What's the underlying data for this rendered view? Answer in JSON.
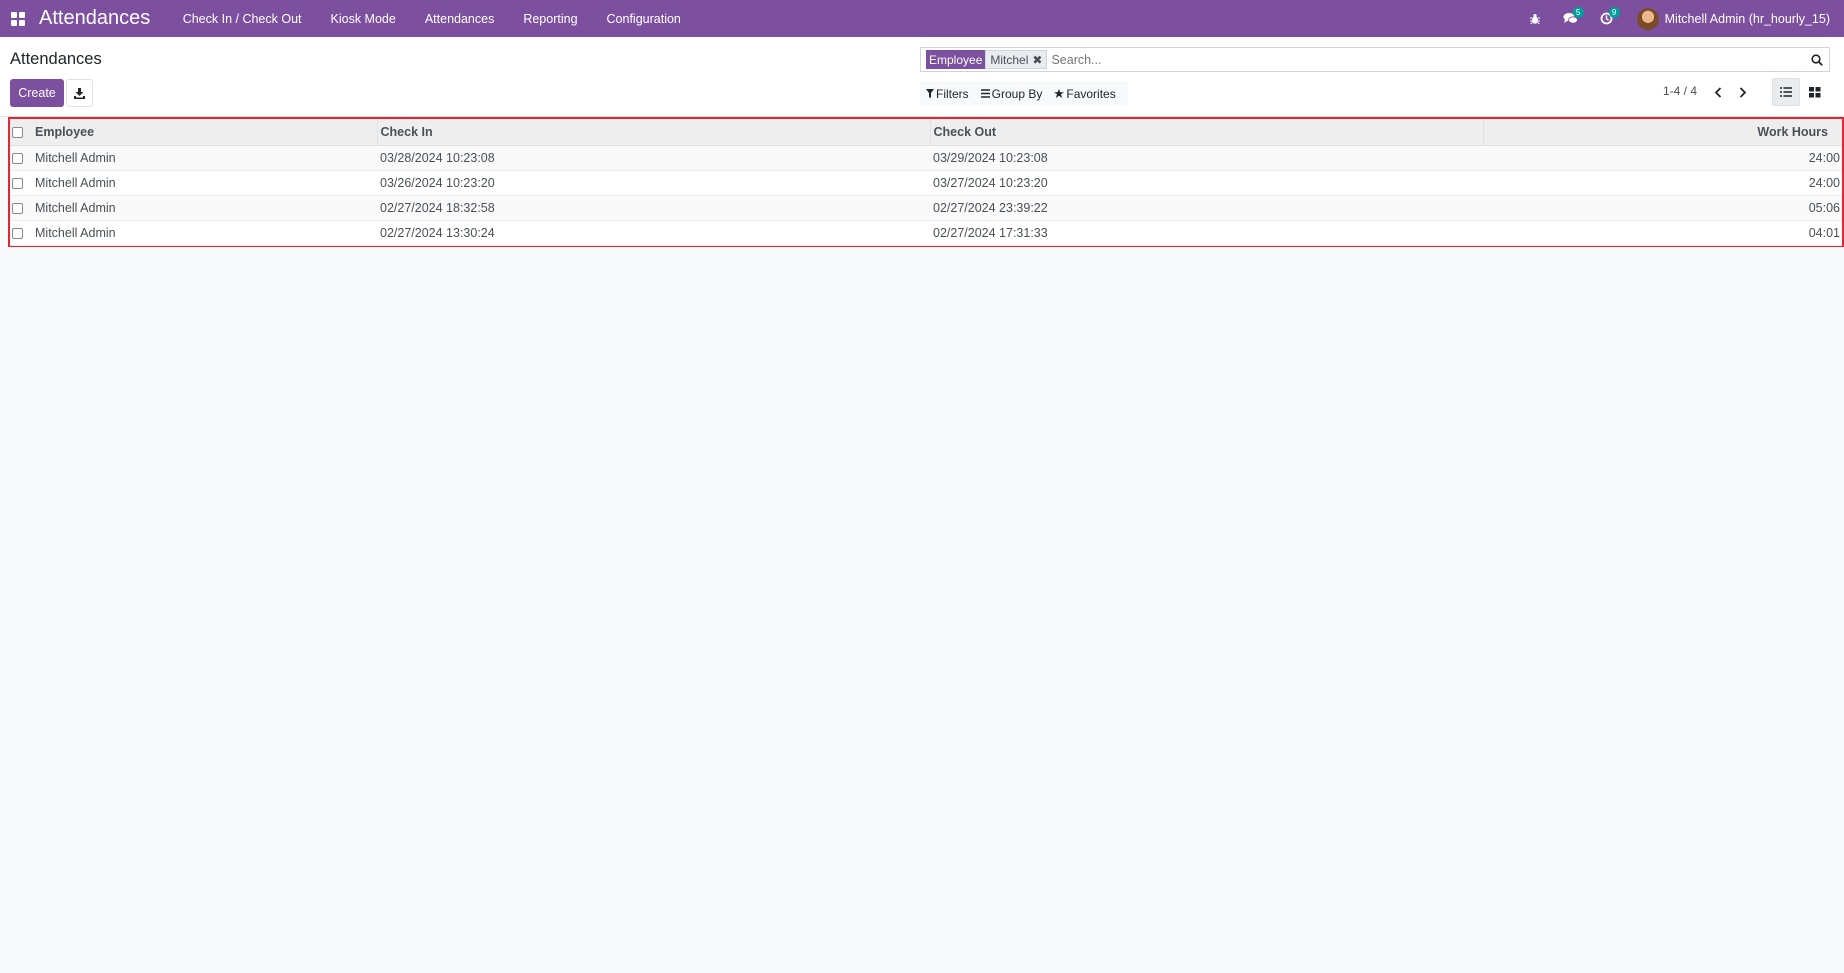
{
  "navbar": {
    "brand": "Attendances",
    "menu": [
      "Check In / Check Out",
      "Kiosk Mode",
      "Attendances",
      "Reporting",
      "Configuration"
    ],
    "icons": {
      "apps": "apps-grid-icon",
      "debug": "bug-icon",
      "messages": "chat-icon",
      "activities": "clock-icon"
    },
    "messages_count": "5",
    "activities_count": "9",
    "user_name": "Mitchell Admin (hr_hourly_15)",
    "color": "#7c4f9f"
  },
  "control_panel": {
    "title": "Attendances",
    "create_label": "Create",
    "search": {
      "facet_label": "Employee",
      "facet_value": "Mitchel",
      "placeholder": "Search..."
    },
    "filters_label": "Filters",
    "groupby_label": "Group By",
    "favorites_label": "Favorites",
    "pager": "1-4 / 4"
  },
  "list": {
    "columns": [
      "Employee",
      "Check In",
      "Check Out",
      "Work Hours"
    ],
    "rows": [
      {
        "employee": "Mitchell Admin",
        "check_in": "03/28/2024 10:23:08",
        "check_out": "03/29/2024 10:23:08",
        "work_hours": "24:00"
      },
      {
        "employee": "Mitchell Admin",
        "check_in": "03/26/2024 10:23:20",
        "check_out": "03/27/2024 10:23:20",
        "work_hours": "24:00"
      },
      {
        "employee": "Mitchell Admin",
        "check_in": "02/27/2024 18:32:58",
        "check_out": "02/27/2024 23:39:22",
        "work_hours": "05:06"
      },
      {
        "employee": "Mitchell Admin",
        "check_in": "02/27/2024 13:30:24",
        "check_out": "02/27/2024 17:31:33",
        "work_hours": "04:01"
      }
    ],
    "highlight_color": "#e2272f"
  }
}
